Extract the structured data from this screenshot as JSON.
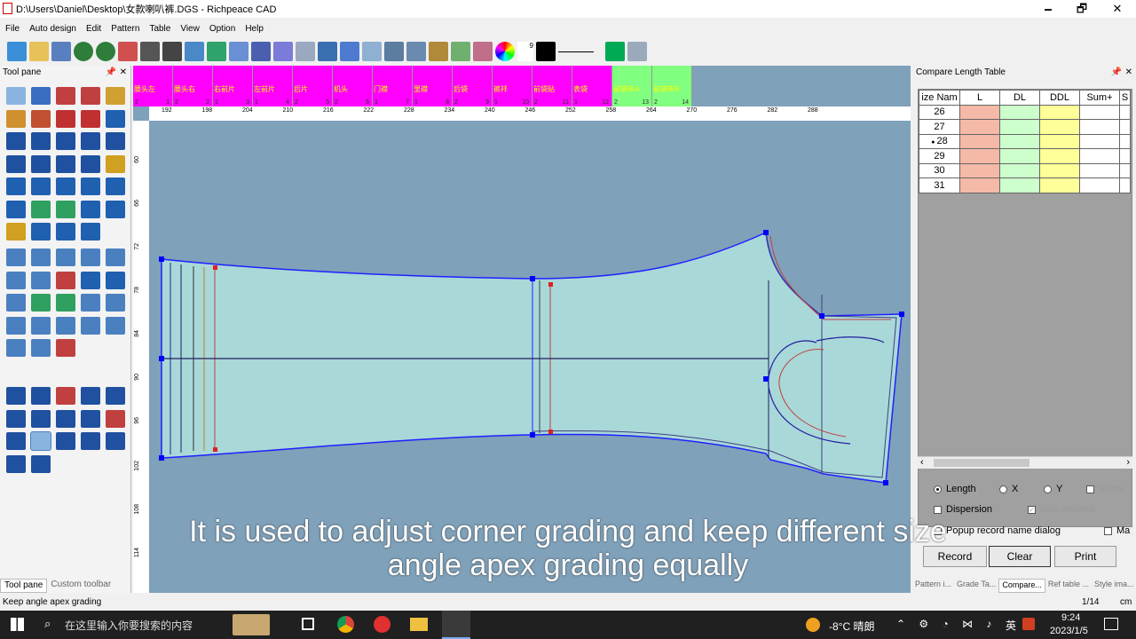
{
  "window": {
    "title": "D:\\Users\\Daniel\\Desktop\\女款喇叭裤.DGS - Richpeace CAD",
    "minimize": "🗕",
    "maximize": "🗗",
    "close": "✕"
  },
  "menu": [
    "File",
    "Auto design",
    "Edit",
    "Pattern",
    "Table",
    "View",
    "Option",
    "Help"
  ],
  "toolbar": {
    "color_number": "9"
  },
  "tool_pane": {
    "title": "Tool pane",
    "pin": "📌",
    "close": "✕",
    "tabs": [
      "Tool pane",
      "Custom toolbar"
    ]
  },
  "pieces": [
    {
      "name": "腰头左",
      "qty": "2",
      "idx": "1"
    },
    {
      "name": "腰头右",
      "qty": "2",
      "idx": "2"
    },
    {
      "name": "右前片",
      "qty": "1",
      "idx": "3"
    },
    {
      "name": "左前片",
      "qty": "1",
      "idx": "4"
    },
    {
      "name": "后片",
      "qty": "2",
      "idx": "5"
    },
    {
      "name": "机头",
      "qty": "2",
      "idx": "6"
    },
    {
      "name": "门襟",
      "qty": "1",
      "idx": "7"
    },
    {
      "name": "里襟",
      "qty": "1",
      "idx": "8"
    },
    {
      "name": "后袋",
      "qty": "2",
      "idx": "9"
    },
    {
      "name": "裤袢",
      "qty": "1",
      "idx": "10"
    },
    {
      "name": "前袋贴",
      "qty": "2",
      "idx": "11"
    },
    {
      "name": "表袋",
      "qty": "1",
      "idx": "12"
    },
    {
      "name": "前袋布A",
      "qty": "2",
      "idx": "13"
    },
    {
      "name": "前袋布B",
      "qty": "2",
      "idx": "14"
    }
  ],
  "ruler": {
    "h": [
      "192",
      "198",
      "204",
      "210",
      "216",
      "222",
      "228",
      "234",
      "240",
      "246",
      "252",
      "258",
      "264",
      "270",
      "276",
      "282",
      "288"
    ],
    "v": [
      "60",
      "66",
      "72",
      "78",
      "84",
      "90",
      "96",
      "102",
      "108",
      "114"
    ],
    "unit": "cm"
  },
  "compare_table": {
    "title": "Compare Length Table",
    "pin": "📌",
    "close": "✕",
    "columns": [
      "ize Nam",
      "L",
      "DL",
      "DDL",
      "Sum+",
      "S"
    ],
    "rows": [
      "26",
      "27",
      "28",
      "29",
      "30",
      "31"
    ],
    "selected_row": "28",
    "scroll_left": "‹",
    "scroll_right": "›"
  },
  "options": {
    "length": "Length",
    "x": "X",
    "y": "Y",
    "show": "Show",
    "dispersion": "Dispersion",
    "inch_decimal": "Inch decimal",
    "popup": "Popup record name dialog",
    "ma": "Ma"
  },
  "buttons": {
    "record": "Record",
    "clear": "Clear",
    "print": "Print"
  },
  "right_tabs": [
    "Pattern i...",
    "Grade Ta...",
    "Compare...",
    "Ref table ...",
    "Style ima..."
  ],
  "status": {
    "text": "Keep angle apex grading",
    "page": "1/14",
    "unit": "cm"
  },
  "caption": {
    "line1": "It is used to adjust corner grading and keep different size",
    "line2": "angle apex grading equally"
  },
  "taskbar": {
    "search": "在这里输入你要搜索的内容",
    "weather": "-8°C 晴朗",
    "ime": "英",
    "time": "9:24",
    "date": "2023/1/5"
  },
  "colors": {
    "magenta": "#ff00ff",
    "green": "#80ff80",
    "canvas": "#7fa1ba",
    "piece_fill": "#a9d8d8"
  }
}
